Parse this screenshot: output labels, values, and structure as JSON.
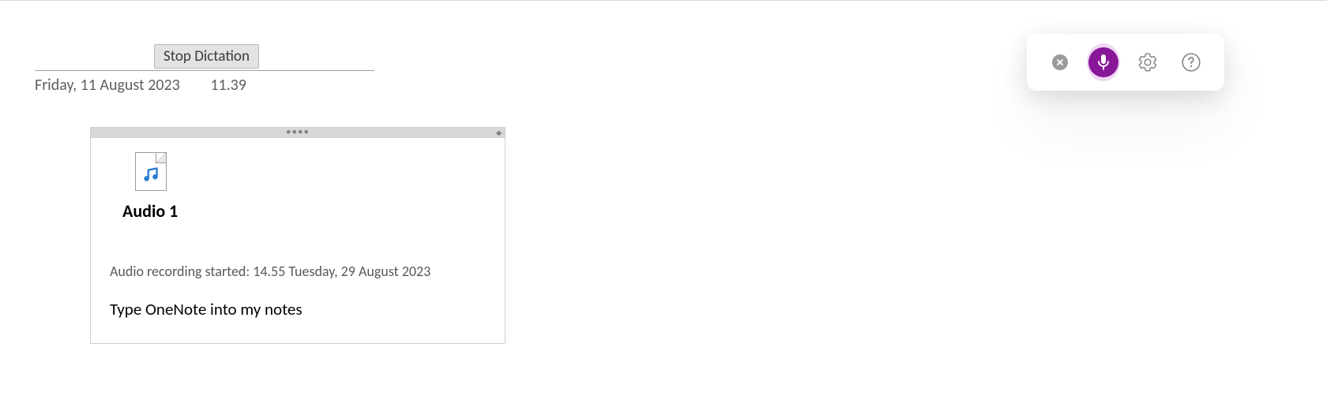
{
  "tooltip": {
    "label": "Stop Dictation"
  },
  "note_header": {
    "date": "Friday, 11 August 2023",
    "time": "11.39"
  },
  "note": {
    "audio_title": "Audio 1",
    "recording_status": "Audio recording started: 14.55 Tuesday, 29 August 2023",
    "text": "Type OneNote into my notes"
  },
  "dictation_toolbar": {
    "close": "close",
    "mic": "microphone",
    "settings": "settings",
    "help": "help"
  }
}
